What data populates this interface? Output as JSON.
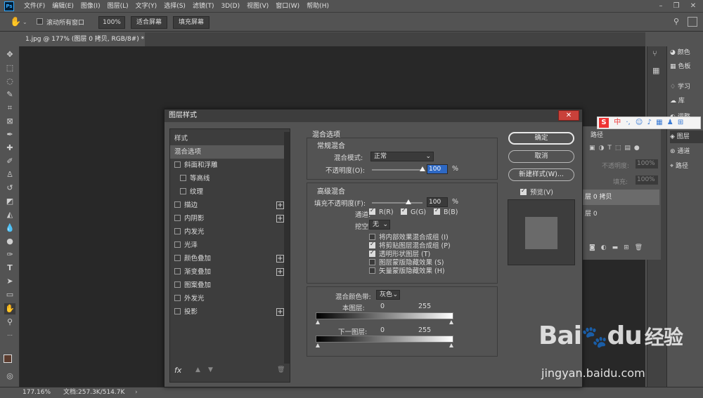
{
  "menubar": {
    "app_icon": "Ps",
    "items": [
      "文件(F)",
      "编辑(E)",
      "图像(I)",
      "图层(L)",
      "文字(Y)",
      "选择(S)",
      "滤镜(T)",
      "3D(D)",
      "视图(V)",
      "窗口(W)",
      "帮助(H)"
    ]
  },
  "options": {
    "scroll_all_label": "滚动所有窗口",
    "zoom_value": "100%",
    "fit_screen": "适合屏幕",
    "fill_screen": "填充屏幕"
  },
  "document_tab": "1.jpg @ 177% (图层 0 拷贝, RGB/8#) *",
  "status": {
    "zoom": "177.16%",
    "doc": "文档:257.3K/514.7K"
  },
  "right_strip": {
    "items": [
      "颜色",
      "色板",
      "学习",
      "库",
      "调整",
      "图层",
      "通道",
      "路径"
    ]
  },
  "layers_panel": {
    "tab": "路径",
    "opacity_label": "不透明度:",
    "opacity_value": "100%",
    "fill_label": "填充:",
    "fill_value": "100%",
    "layers": [
      "层 0 拷贝",
      "层 0"
    ]
  },
  "dialog": {
    "title": "图层样式",
    "close": "✕",
    "styles_header": "样式",
    "blend_options_item": "混合选项",
    "effects": [
      {
        "label": "斜面和浮雕",
        "plus": false,
        "indent": false
      },
      {
        "label": "等高线",
        "plus": false,
        "indent": true
      },
      {
        "label": "纹理",
        "plus": false,
        "indent": true
      },
      {
        "label": "描边",
        "plus": true,
        "indent": false
      },
      {
        "label": "内阴影",
        "plus": true,
        "indent": false
      },
      {
        "label": "内发光",
        "plus": false,
        "indent": false
      },
      {
        "label": "光泽",
        "plus": false,
        "indent": false
      },
      {
        "label": "颜色叠加",
        "plus": true,
        "indent": false
      },
      {
        "label": "渐变叠加",
        "plus": true,
        "indent": false
      },
      {
        "label": "图案叠加",
        "plus": false,
        "indent": false
      },
      {
        "label": "外发光",
        "plus": false,
        "indent": false
      },
      {
        "label": "投影",
        "plus": true,
        "indent": false
      }
    ],
    "fx": "fx",
    "main": {
      "section_title": "混合选项",
      "general_title": "常规混合",
      "blend_mode_label": "混合模式:",
      "blend_mode_value": "正常",
      "opacity_label": "不透明度(O):",
      "opacity_value": "100",
      "percent": "%",
      "advanced_title": "高级混合",
      "fill_opacity_label": "填充不透明度(F):",
      "fill_opacity_value": "100",
      "channels_label": "通道:",
      "channel_r": "R(R)",
      "channel_g": "G(G)",
      "channel_b": "B(B)",
      "knockout_label": "挖空:",
      "knockout_value": "无",
      "options": [
        {
          "label": "将内部效果混合成组 (I)",
          "checked": false
        },
        {
          "label": "将剪贴图层混合成组 (P)",
          "checked": true
        },
        {
          "label": "透明形状图层 (T)",
          "checked": true
        },
        {
          "label": "图层蒙版隐藏效果 (S)",
          "checked": false
        },
        {
          "label": "矢量蒙版隐藏效果 (H)",
          "checked": false
        }
      ],
      "blend_if_label": "混合颜色带:",
      "blend_if_value": "灰色",
      "this_layer_label": "本图层:",
      "underlying_label": "下一图层:",
      "val0": "0",
      "val255": "255"
    },
    "buttons": {
      "ok": "确定",
      "cancel": "取消",
      "new_style": "新建样式(W)...",
      "preview": "预览(V)"
    }
  },
  "watermark": {
    "logo": "Bai",
    "logo2": "du",
    "brand": "经验",
    "url": "jingyan.baidu.com"
  },
  "ime_bar": {
    "letter": "S",
    "text": "中"
  }
}
